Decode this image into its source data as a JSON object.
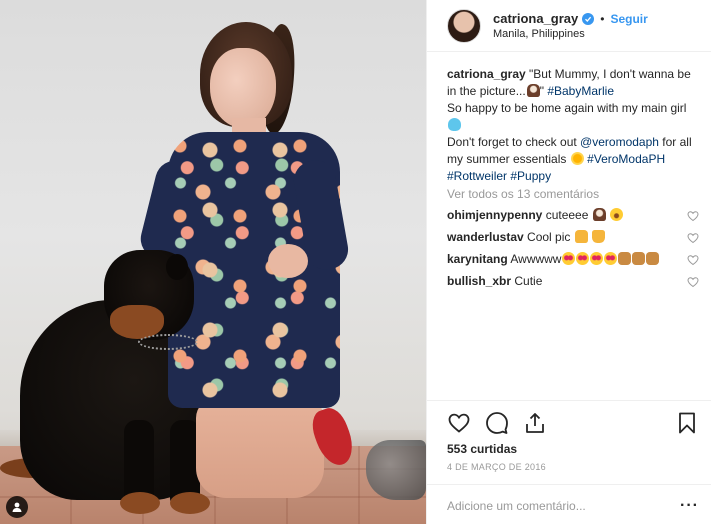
{
  "header": {
    "username": "catriona_gray",
    "separator": "•",
    "follow_label": "Seguir",
    "location": "Manila, Philippines"
  },
  "caption": {
    "username": "catriona_gray",
    "text_1": "\"But Mummy, I don't wanna be in the picture...",
    "text_2": "\"",
    "hashtag_1": "#BabyMarlie",
    "text_3": "So happy to be home again with my main girl",
    "text_4": "Don't forget to check out",
    "mention": "@veromodaph",
    "text_5": "for all my summer essentials",
    "hashtag_2": "#VeroModaPH",
    "hashtag_3": "#Rottweiler",
    "hashtag_4": "#Puppy"
  },
  "view_all_comments": "Ver todos os 13 comentários",
  "comments": [
    {
      "user": "ohimjennypenny",
      "text": "cuteeee"
    },
    {
      "user": "wanderlustav",
      "text": "Cool pic"
    },
    {
      "user": "karynitang",
      "text": "Awwwww"
    },
    {
      "user": "bullish_xbr",
      "text": "Cutie"
    }
  ],
  "likes": "553 curtidas",
  "date": "4 DE MARÇO DE 2016",
  "comment_input": {
    "placeholder": "Adicione um comentário..."
  },
  "icons": {
    "like": "heart-icon",
    "comment": "comment-icon",
    "share": "share-icon",
    "save": "bookmark-icon",
    "more": "more-options-icon",
    "tag": "person-tag-icon",
    "verified": "verified-badge-icon"
  },
  "colors": {
    "accent": "#3897f0",
    "text": "#262626",
    "muted": "#999999",
    "link": "#003569",
    "border": "#efefef"
  }
}
